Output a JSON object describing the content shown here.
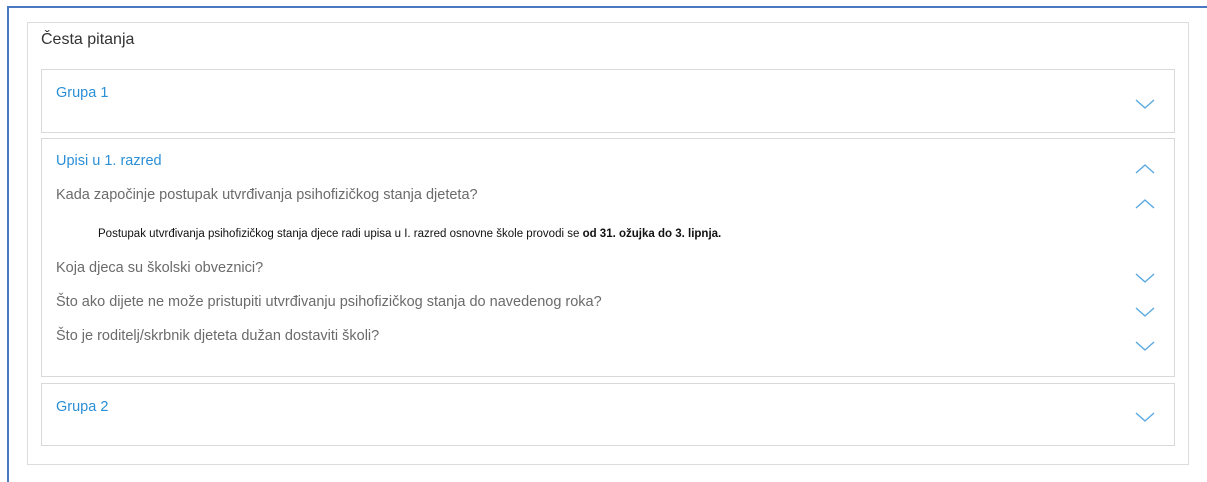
{
  "panel": {
    "title": "Česta pitanja"
  },
  "groups": [
    {
      "title": "Grupa 1",
      "expanded": false,
      "icon": "chevron-down-icon"
    },
    {
      "title": "Upisi u 1. razred",
      "expanded": true,
      "icon": "chevron-up-icon",
      "questions": [
        {
          "text": "Kada započinje postupak utvrđivanja psihofizičkog stanja djeteta?",
          "expanded": true,
          "icon": "chevron-up-icon",
          "answer_plain": "Postupak utvrđivanja psihofizičkog stanja djece radi upisa u I. razred osnovne škole provodi se ",
          "answer_bold": "od 31. ožujka do 3. lipnja."
        },
        {
          "text": "Koja djeca su školski obveznici?",
          "expanded": false,
          "icon": "chevron-down-icon"
        },
        {
          "text": "Što ako dijete ne može pristupiti utvrđivanju psihofizičkog stanja do navedenog roka?",
          "expanded": false,
          "icon": "chevron-down-icon"
        },
        {
          "text": "Što je roditelj/skrbnik djeteta dužan dostaviti školi?",
          "expanded": false,
          "icon": "chevron-down-icon"
        }
      ]
    },
    {
      "title": "Grupa 2",
      "expanded": false,
      "icon": "chevron-down-icon"
    }
  ],
  "colors": {
    "accent": "#2a8fd6",
    "chevron": "#5aa9e0",
    "question_text": "#6b6b6b",
    "frame": "#4a78c2"
  }
}
